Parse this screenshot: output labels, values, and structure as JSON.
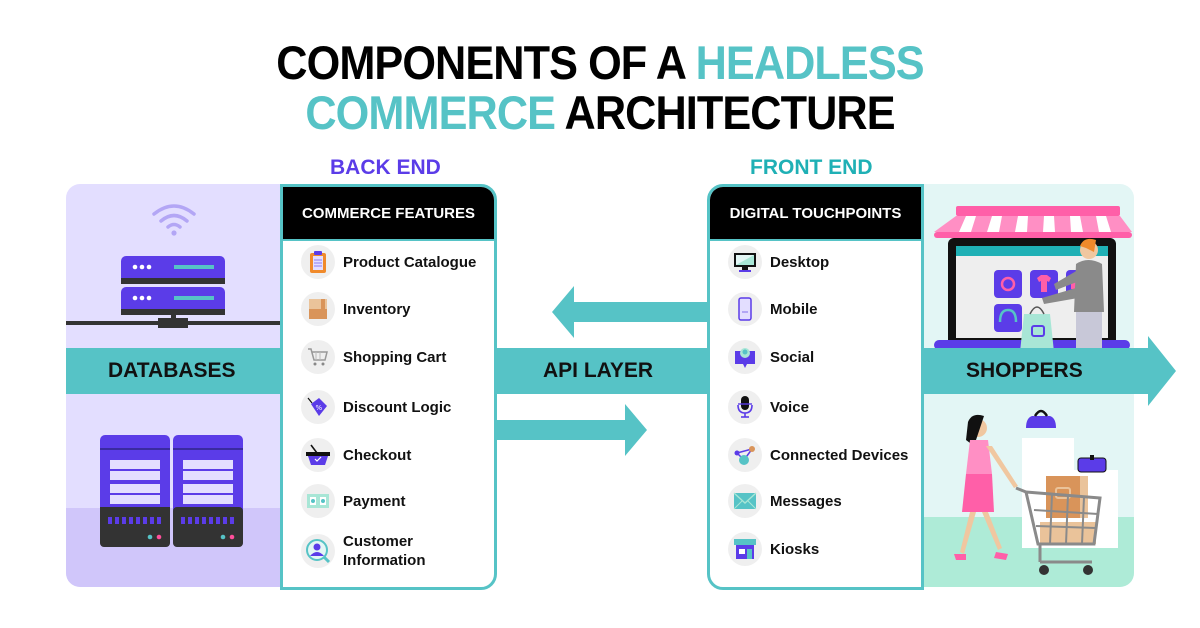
{
  "title": {
    "line1_dark": "COMPONENTS OF A",
    "line1_highlight": "HEADLESS",
    "line2_highlight": "COMMERCE",
    "line2_dark": "ARCHITECTURE"
  },
  "colors": {
    "teal": "#56c3c6",
    "purple": "#5b3ce8",
    "frontend_teal": "#1fb0b5",
    "black": "#000000"
  },
  "back_end": {
    "label": "BACK END",
    "databases_label": "DATABASES",
    "card_title": "COMMERCE FEATURES",
    "items": [
      {
        "label": "Product Catalogue",
        "icon": "clipboard-icon"
      },
      {
        "label": "Inventory",
        "icon": "box-icon"
      },
      {
        "label": "Shopping Cart",
        "icon": "cart-icon"
      },
      {
        "label": "Discount Logic",
        "icon": "tag-icon"
      },
      {
        "label": "Checkout",
        "icon": "basket-icon"
      },
      {
        "label": "Payment",
        "icon": "money-icon"
      },
      {
        "label": "Customer Information",
        "icon": "user-search-icon"
      }
    ]
  },
  "api": {
    "label": "API LAYER"
  },
  "front_end": {
    "label": "FRONT END",
    "card_title": "DIGITAL TOUCHPOINTS",
    "shoppers_label": "SHOPPERS",
    "items": [
      {
        "label": "Desktop",
        "icon": "monitor-icon"
      },
      {
        "label": "Mobile",
        "icon": "phone-icon"
      },
      {
        "label": "Social",
        "icon": "chat-user-icon"
      },
      {
        "label": "Voice",
        "icon": "microphone-icon"
      },
      {
        "label": "Connected Devices",
        "icon": "network-icon"
      },
      {
        "label": "Messages",
        "icon": "envelope-icon"
      },
      {
        "label": "Kiosks",
        "icon": "storefront-icon"
      }
    ]
  }
}
